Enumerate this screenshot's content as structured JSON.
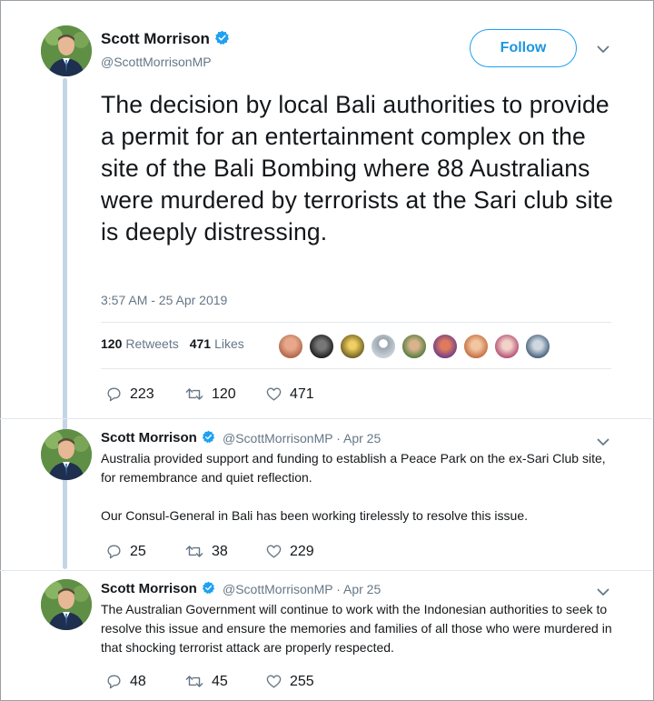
{
  "author": {
    "name": "Scott Morrison",
    "handle": "@ScottMorrisonMP"
  },
  "follow_label": "Follow",
  "main_tweet": {
    "text": "The decision by local Bali authorities to provide a permit for an entertainment complex on the site of the Bali Bombing where 88 Australians were murdered by terrorists at the Sari club site is deeply distressing.",
    "timestamp": "3:57 AM - 25 Apr 2019",
    "retweets_count": "120",
    "retweets_label": "Retweets",
    "likes_count": "471",
    "likes_label": "Likes",
    "actions": {
      "replies": "223",
      "retweets": "120",
      "likes": "471"
    }
  },
  "replies": [
    {
      "name": "Scott Morrison",
      "meta": "@ScottMorrisonMP · Apr 25",
      "paragraphs": [
        "Australia provided support and funding to establish a Peace Park on the ex-Sari Club site, for remembrance and quiet reflection.",
        "Our Consul-General in Bali has been working tirelessly to resolve this issue."
      ],
      "actions": {
        "replies": "25",
        "retweets": "38",
        "likes": "229"
      }
    },
    {
      "name": "Scott Morrison",
      "meta": "@ScottMorrisonMP · Apr 25",
      "paragraphs": [
        "The Australian Government will continue to work with the Indonesian authorities to seek to resolve this issue and ensure the memories and families of all those who were murdered in that shocking terrorist attack are properly respected."
      ],
      "actions": {
        "replies": "48",
        "retweets": "45",
        "likes": "255"
      }
    }
  ],
  "colors": {
    "accent": "#1da1f2",
    "thread_line": "#c4d6e6",
    "muted": "#657786"
  },
  "icons": [
    "verified-badge-icon",
    "chevron-down-icon",
    "reply-icon",
    "retweet-icon",
    "heart-icon"
  ]
}
